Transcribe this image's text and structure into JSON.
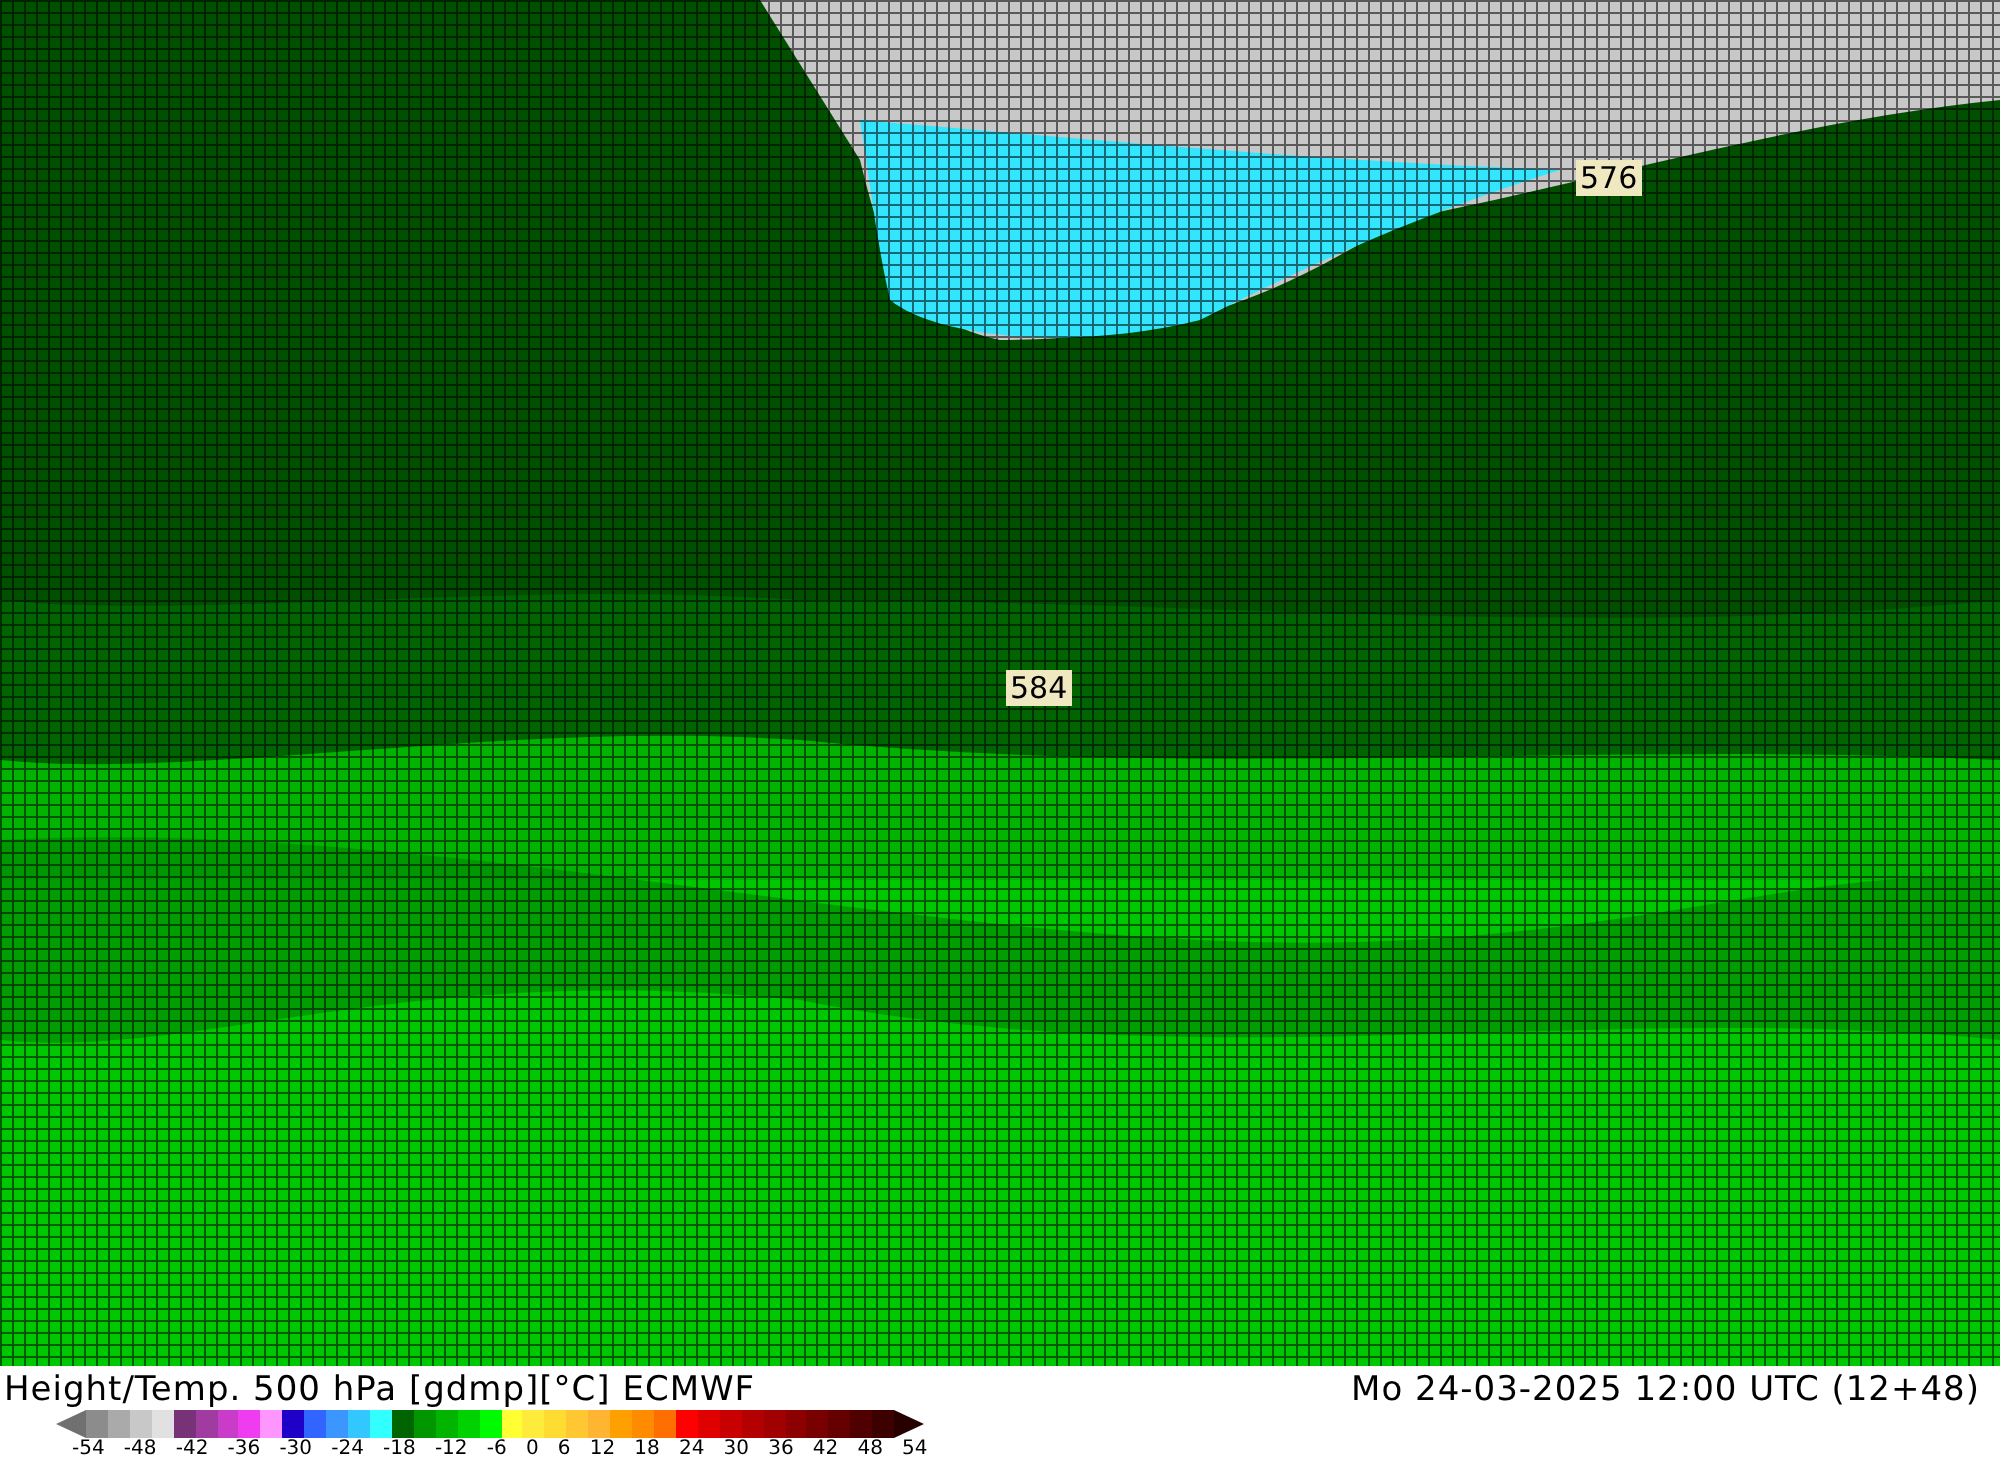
{
  "map": {
    "contour_labels": [
      "576",
      "584"
    ]
  },
  "footer": {
    "title": "Height/Temp. 500 hPa [gdmp][°C] ECMWF",
    "valid_time": "Mo 24-03-2025 12:00 UTC (12+48)"
  },
  "legend": {
    "swatches": [
      {
        "color": "#8c8c8c"
      },
      {
        "color": "#aaaaaa"
      },
      {
        "color": "#c8c8c8"
      },
      {
        "color": "#e1e1e1"
      },
      {
        "color": "#783278"
      },
      {
        "color": "#a03ca0"
      },
      {
        "color": "#c83cc8"
      },
      {
        "color": "#f03cf0"
      },
      {
        "color": "#ff96ff"
      },
      {
        "color": "#1e00c8"
      },
      {
        "color": "#3264ff"
      },
      {
        "color": "#3c96ff"
      },
      {
        "color": "#32c8ff"
      },
      {
        "color": "#32ffff"
      },
      {
        "color": "#006400"
      },
      {
        "color": "#009600"
      },
      {
        "color": "#00b400"
      },
      {
        "color": "#00d200"
      },
      {
        "color": "#00fa00"
      },
      {
        "color": "#ffff32"
      },
      {
        "color": "#ffeb3c"
      },
      {
        "color": "#ffdc32"
      },
      {
        "color": "#ffc832"
      },
      {
        "color": "#ffb432"
      },
      {
        "color": "#ffa000"
      },
      {
        "color": "#ff8c00"
      },
      {
        "color": "#ff6e00"
      },
      {
        "color": "#ff0000"
      },
      {
        "color": "#e10000"
      },
      {
        "color": "#c80000"
      },
      {
        "color": "#b40000"
      },
      {
        "color": "#a00000"
      },
      {
        "color": "#8c0000"
      },
      {
        "color": "#780000"
      },
      {
        "color": "#640000"
      },
      {
        "color": "#500000"
      },
      {
        "color": "#3c0000"
      }
    ],
    "ticks": [
      "-54",
      "-48",
      "-42",
      "-36",
      "-30",
      "-24",
      "-18",
      "-12",
      "-6",
      "0",
      "6",
      "12",
      "18",
      "24",
      "30",
      "36",
      "42",
      "48",
      "54"
    ]
  }
}
